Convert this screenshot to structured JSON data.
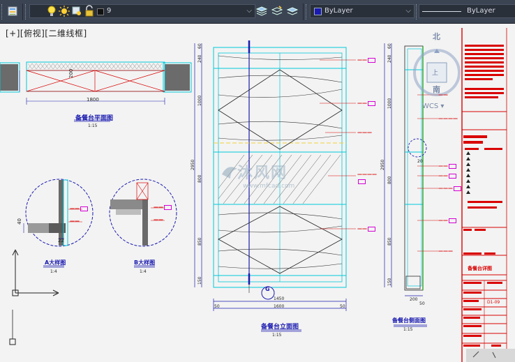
{
  "toolbar": {
    "layer_name": "9",
    "color_value": "ByLayer",
    "linetype_value": "ByLayer"
  },
  "viewport": {
    "label": "[+][俯视][二维线框]"
  },
  "viewcube": {
    "north": "北",
    "south": "南",
    "top": "上",
    "ucs_label": "WCS"
  },
  "drawing": {
    "plan_view": {
      "title": "备餐台平面图",
      "scale": "1:15",
      "dim_width": "1800",
      "dim_height": "200"
    },
    "detail_a": {
      "title": "A大样图",
      "scale": "1:4",
      "dim_1": "40",
      "dim_2": "22"
    },
    "detail_b": {
      "title": "B大样图",
      "scale": "1:4"
    },
    "elevation": {
      "title": "备餐台立面图",
      "scale": "1:15",
      "dims_left": [
        "60",
        "240",
        "1000",
        "2950",
        "800",
        "850",
        "150"
      ],
      "dim_bottom_inner": "1450",
      "dim_bottom_total": "1600",
      "dim_bottom_left": "50",
      "dim_bottom_right": "50",
      "marker_g": "G"
    },
    "section": {
      "title": "备餐台侧面图",
      "scale": "1:15",
      "dims_left": [
        "60",
        "240",
        "1000",
        "2950",
        "800",
        "850",
        "150"
      ],
      "dim_bottom": "200",
      "dim_bottom_small": "50",
      "dim_side": "20"
    },
    "watermark": {
      "brand": "沐风网",
      "url": "www.mfcad.com"
    },
    "title_block": {
      "label_1": "备餐台详图",
      "label_2": "D1-09"
    }
  },
  "colors": {
    "toolbar_bg": "#3b4453",
    "canvas_bg": "#f3f3f3",
    "cad_red": "#d90000",
    "cad_cyan": "#00c8d8",
    "cad_magenta": "#d400d4",
    "cad_blue": "#1a1ab0"
  },
  "icons": [
    "layer-properties-icon",
    "lightbulb-icon",
    "sun-icon",
    "freeze-icon",
    "lock-icon",
    "layer-state-icon",
    "layer-match-icon",
    "layer-previous-icon"
  ]
}
